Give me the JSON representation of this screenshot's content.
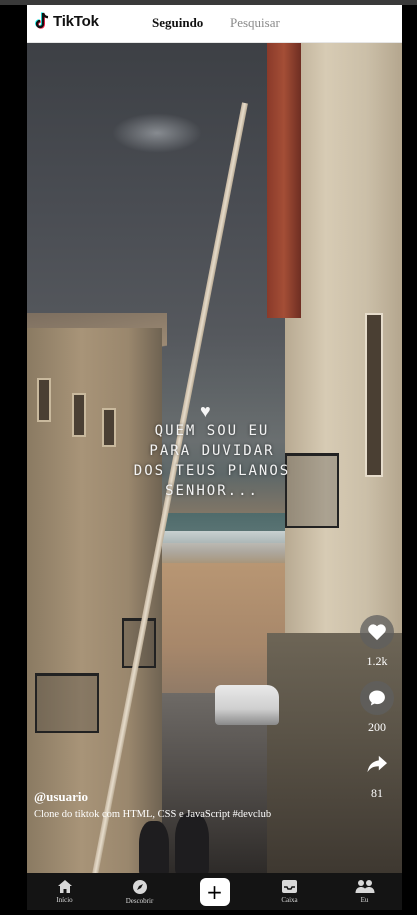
{
  "header": {
    "logo_text": "TikTok",
    "tabs": [
      {
        "label": "Seguindo",
        "active": true
      },
      {
        "label": "Pesquisar",
        "active": false
      }
    ]
  },
  "video": {
    "overlay_lines": [
      "QUEM SOU EU",
      "PARA DUVIDAR",
      "DOS TEUS PLANOS",
      "SENHOR..."
    ],
    "overlay_icon": "heart-icon",
    "username": "@usuario",
    "description": "Clone do tiktok com HTML, CSS e JavaScript #devclub"
  },
  "actions": [
    {
      "icon": "heart-icon",
      "count": "1.2k"
    },
    {
      "icon": "comment-icon",
      "count": "200"
    },
    {
      "icon": "share-icon",
      "count": "81"
    }
  ],
  "bottom_nav": [
    {
      "icon": "home-icon",
      "label": "Início"
    },
    {
      "icon": "compass-icon",
      "label": "Descobrir"
    },
    {
      "icon": "plus-icon",
      "label": ""
    },
    {
      "icon": "inbox-icon",
      "label": "Caixa"
    },
    {
      "icon": "profile-icon",
      "label": "Eu"
    }
  ],
  "colors": {
    "header_bg": "#ffffff",
    "nav_bg": "#141414",
    "action_button_bg": "#5f5f5f"
  }
}
